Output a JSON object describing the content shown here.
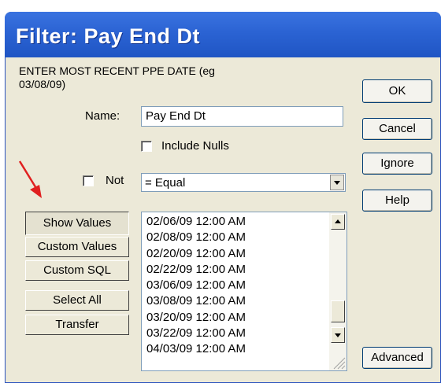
{
  "window": {
    "title": "Filter: Pay End Dt",
    "instruction": "ENTER MOST RECENT PPE DATE (eg 03/08/09)"
  },
  "form": {
    "name_label": "Name:",
    "name_value": "Pay End Dt",
    "include_nulls_label": "Include Nulls",
    "not_label": "Not",
    "operator_value": "= Equal"
  },
  "side_buttons": {
    "show_values": "Show Values",
    "custom_values": "Custom Values",
    "custom_sql": "Custom SQL",
    "select_all": "Select All",
    "transfer": "Transfer"
  },
  "values_list": [
    "02/06/09 12:00 AM",
    "02/08/09 12:00 AM",
    "02/20/09 12:00 AM",
    "02/22/09 12:00 AM",
    "03/06/09 12:00 AM",
    "03/08/09 12:00 AM",
    "03/20/09 12:00 AM",
    "03/22/09 12:00 AM",
    "04/03/09 12:00 AM"
  ],
  "right_buttons": {
    "ok": "OK",
    "cancel": "Cancel",
    "ignore": "Ignore",
    "help": "Help",
    "advanced": "Advanced"
  },
  "colors": {
    "title_bar": "#2b63d3",
    "dialog_bg": "#ece9d8",
    "annotation_arrow": "#e02020"
  },
  "icons": {
    "annotation": "red-arrow-icon",
    "dropdown": "chevron-down-icon",
    "scroll_up": "scroll-up-icon",
    "scroll_down": "scroll-down-icon",
    "resize": "resize-grip-icon"
  }
}
